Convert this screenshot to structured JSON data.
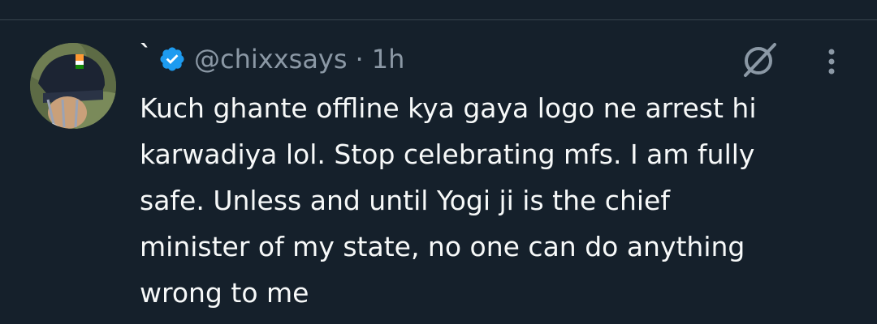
{
  "tweet": {
    "display_name": "`",
    "verified": true,
    "handle": "@chixxsays",
    "separator": "·",
    "time": "1h",
    "text": "Kuch ghante offline kya gaya logo ne arrest hi\nkarwadiya lol. Stop celebrating mfs. I am fully\nsafe. Unless and until Yogi ji is the chief\nminister of my state, no one can do anything\nwrong to me"
  },
  "icons": {
    "verified": "verified-badge-icon",
    "grok": "grok-icon",
    "more": "more-options-icon"
  },
  "colors": {
    "background": "#15202b",
    "text": "#f7f9f9",
    "secondary_text": "#8b98a5",
    "verified_blue": "#1d9bf0",
    "divider": "#38444d"
  }
}
